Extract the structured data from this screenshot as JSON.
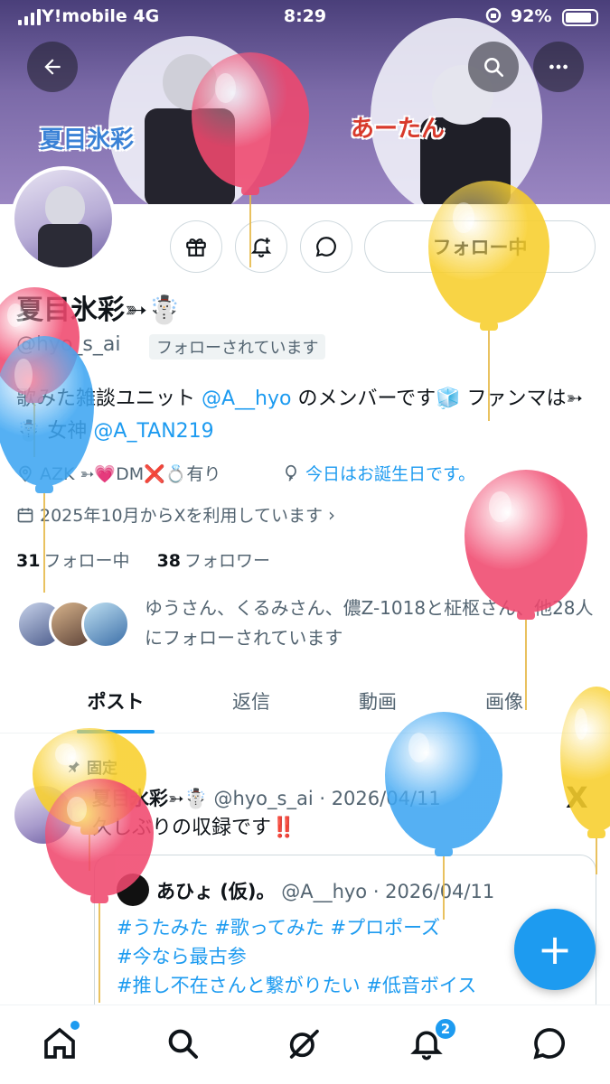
{
  "status_bar": {
    "carrier": "Y!mobile  4G",
    "time": "8:29",
    "battery": "92%"
  },
  "banner": {
    "label_left": "夏目氷彩",
    "label_right": "あーたん"
  },
  "profile": {
    "name": "夏目氷彩➳☃️",
    "handle": "@hyo_s_ai",
    "follows_you": "フォローされています",
    "follow_button": "フォロー中",
    "bio_prefix": "歌みた雑談ユニット ",
    "bio_link1": "@A__hyo",
    "bio_middle": " のメンバーです🧊 ファンマは➳☃️ 女神 ",
    "bio_link2": "@A_TAN219",
    "location": "AZK ➳💗DM❌💍有り",
    "birthday": "今日はお誕生日です。",
    "joined": "2025年10月からXを利用しています",
    "following_count": "31",
    "following_label": "フォロー中",
    "followers_count": "38",
    "followers_label": "フォロワー",
    "mutual_text": "ゆうさん、くるみさん、儂Z-1018と柾枢さん、他28人にフォローされています"
  },
  "tabs": [
    "ポスト",
    "返信",
    "動画",
    "画像"
  ],
  "post": {
    "pinned_label": "固定",
    "author": "夏目氷彩➳☃️",
    "handle_date": "@hyo_s_ai · 2026/04/11",
    "text": "久しぶりの収録です‼️",
    "x_logo": "X",
    "quote": {
      "author": "あひょ (仮)。",
      "handle_date": "@A__hyo · 2026/04/11",
      "line1": "#うたみた #歌ってみた #プロポーズ",
      "line2": "#今なら最古参",
      "line3": "#推し不在さんと繋がりたい #低音ボイス"
    }
  },
  "fab_label": "+",
  "notifications_badge": "2",
  "colors": {
    "accent": "#1d9bf0",
    "balloon_pink": "#f0486e",
    "balloon_yellow": "#f8cf2c",
    "balloon_blue": "#3ea6f2"
  }
}
